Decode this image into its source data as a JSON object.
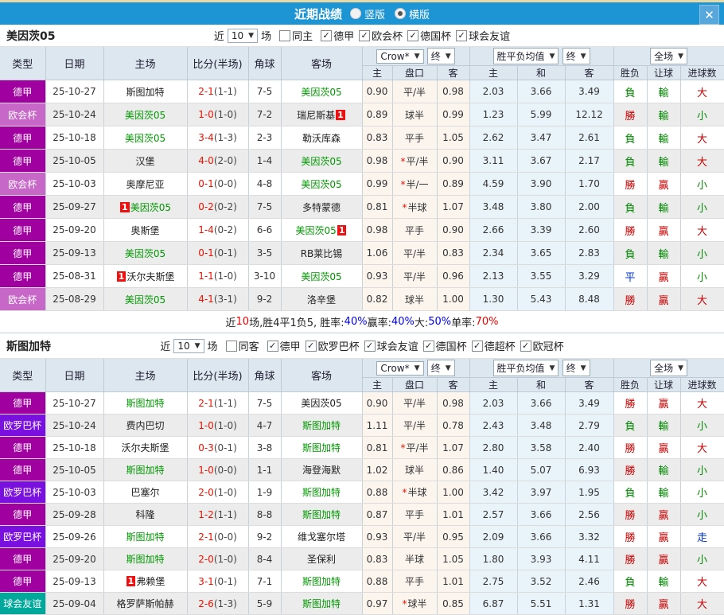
{
  "icons": {
    "close": "✕",
    "dropdown": "▼",
    "check": "✓"
  },
  "titlebar": {
    "title": "近期战绩",
    "radio_vertical": "竖版",
    "radio_horizontal": "横版",
    "selected": "横版"
  },
  "columns": {
    "type": "类型",
    "date": "日期",
    "home": "主场",
    "score": "比分(半场)",
    "corner": "角球",
    "away": "客场",
    "odds_select": "Crow*",
    "final_select": "终",
    "avg_select": "胜平负均值",
    "scope_select": "全场",
    "home_odds": "主",
    "handicap": "盘口",
    "away_odds": "客",
    "avg_home": "主",
    "avg_draw": "和",
    "avg_away": "客",
    "result": "胜负",
    "let_ball": "让球",
    "goals": "进球数"
  },
  "comp_colors": {
    "德甲": "#a000a0",
    "欧会杯": "#c767c7",
    "欧罗巴杯": "#7a10e0",
    "球会友谊": "#00a89b"
  },
  "sections": [
    {
      "team": "美因茨05",
      "filter": {
        "near": "近",
        "games": "10",
        "suffix": "场",
        "same_label": "同主",
        "same_checked": false,
        "leagues": [
          {
            "label": "德甲",
            "checked": true
          },
          {
            "label": "欧会杯",
            "checked": true
          },
          {
            "label": "德国杯",
            "checked": true
          },
          {
            "label": "球会友谊",
            "checked": true
          }
        ]
      },
      "rows": [
        {
          "comp": "德甲",
          "date": "25-10-27",
          "home": "斯图加特",
          "hg": false,
          "hc": null,
          "score": "2-1",
          "half": "(1-1)",
          "corner": "7-5",
          "away": "美因茨05",
          "ag": true,
          "ac": null,
          "odds": [
            "0.90",
            "平/半",
            "0.98"
          ],
          "star": false,
          "avg": [
            "2.03",
            "3.66",
            "3.49"
          ],
          "res": {
            "t": "負",
            "c": "green"
          },
          "let": {
            "t": "輸",
            "c": "green"
          },
          "goal": {
            "t": "大",
            "c": "red"
          }
        },
        {
          "comp": "欧会杯",
          "date": "25-10-24",
          "home": "美因茨05",
          "hg": true,
          "hc": null,
          "score": "1-0",
          "half": "(1-0)",
          "corner": "7-2",
          "away": "瑞尼斯基",
          "ag": false,
          "ac": "after",
          "odds": [
            "0.89",
            "球半",
            "0.99"
          ],
          "star": false,
          "avg": [
            "1.23",
            "5.99",
            "12.12"
          ],
          "res": {
            "t": "勝",
            "c": "red"
          },
          "let": {
            "t": "輸",
            "c": "green"
          },
          "goal": {
            "t": "小",
            "c": "green"
          }
        },
        {
          "comp": "德甲",
          "date": "25-10-18",
          "home": "美因茨05",
          "hg": true,
          "hc": null,
          "score": "3-4",
          "half": "(1-3)",
          "corner": "2-3",
          "away": "勒沃库森",
          "ag": false,
          "ac": null,
          "odds": [
            "0.83",
            "平手",
            "1.05"
          ],
          "star": false,
          "avg": [
            "2.62",
            "3.47",
            "2.61"
          ],
          "res": {
            "t": "負",
            "c": "green"
          },
          "let": {
            "t": "輸",
            "c": "green"
          },
          "goal": {
            "t": "大",
            "c": "red"
          }
        },
        {
          "comp": "德甲",
          "date": "25-10-05",
          "home": "汉堡",
          "hg": false,
          "hc": null,
          "score": "4-0",
          "half": "(2-0)",
          "corner": "1-4",
          "away": "美因茨05",
          "ag": true,
          "ac": null,
          "odds": [
            "0.98",
            "平/半",
            "0.90"
          ],
          "star": true,
          "avg": [
            "3.11",
            "3.67",
            "2.17"
          ],
          "res": {
            "t": "負",
            "c": "green"
          },
          "let": {
            "t": "輸",
            "c": "green"
          },
          "goal": {
            "t": "大",
            "c": "red"
          }
        },
        {
          "comp": "欧会杯",
          "date": "25-10-03",
          "home": "奥摩尼亚",
          "hg": false,
          "hc": null,
          "score": "0-1",
          "half": "(0-0)",
          "corner": "4-8",
          "away": "美因茨05",
          "ag": true,
          "ac": null,
          "odds": [
            "0.99",
            "半/一",
            "0.89"
          ],
          "star": true,
          "avg": [
            "4.59",
            "3.90",
            "1.70"
          ],
          "res": {
            "t": "勝",
            "c": "red"
          },
          "let": {
            "t": "贏",
            "c": "red"
          },
          "goal": {
            "t": "小",
            "c": "green"
          }
        },
        {
          "comp": "德甲",
          "date": "25-09-27",
          "home": "美因茨05",
          "hg": true,
          "hc": "before",
          "score": "0-2",
          "half": "(0-2)",
          "corner": "7-5",
          "away": "多特蒙德",
          "ag": false,
          "ac": null,
          "odds": [
            "0.81",
            "半球",
            "1.07"
          ],
          "star": true,
          "avg": [
            "3.48",
            "3.80",
            "2.00"
          ],
          "res": {
            "t": "負",
            "c": "green"
          },
          "let": {
            "t": "輸",
            "c": "green"
          },
          "goal": {
            "t": "小",
            "c": "green"
          }
        },
        {
          "comp": "德甲",
          "date": "25-09-20",
          "home": "奥斯堡",
          "hg": false,
          "hc": null,
          "score": "1-4",
          "half": "(0-2)",
          "corner": "6-6",
          "away": "美因茨05",
          "ag": true,
          "ac": "after",
          "odds": [
            "0.98",
            "平手",
            "0.90"
          ],
          "star": false,
          "avg": [
            "2.66",
            "3.39",
            "2.60"
          ],
          "res": {
            "t": "勝",
            "c": "red"
          },
          "let": {
            "t": "贏",
            "c": "red"
          },
          "goal": {
            "t": "大",
            "c": "red"
          }
        },
        {
          "comp": "德甲",
          "date": "25-09-13",
          "home": "美因茨05",
          "hg": true,
          "hc": null,
          "score": "0-1",
          "half": "(0-1)",
          "corner": "3-5",
          "away": "RB莱比锡",
          "ag": false,
          "ac": null,
          "odds": [
            "1.06",
            "平/半",
            "0.83"
          ],
          "star": false,
          "avg": [
            "2.34",
            "3.65",
            "2.83"
          ],
          "res": {
            "t": "負",
            "c": "green"
          },
          "let": {
            "t": "輸",
            "c": "green"
          },
          "goal": {
            "t": "小",
            "c": "green"
          }
        },
        {
          "comp": "德甲",
          "date": "25-08-31",
          "home": "沃尔夫斯堡",
          "hg": false,
          "hc": "before",
          "score": "1-1",
          "half": "(1-0)",
          "corner": "3-10",
          "away": "美因茨05",
          "ag": true,
          "ac": null,
          "odds": [
            "0.93",
            "平/半",
            "0.96"
          ],
          "star": false,
          "avg": [
            "2.13",
            "3.55",
            "3.29"
          ],
          "res": {
            "t": "平",
            "c": "blue"
          },
          "let": {
            "t": "贏",
            "c": "red"
          },
          "goal": {
            "t": "小",
            "c": "green"
          }
        },
        {
          "comp": "欧会杯",
          "date": "25-08-29",
          "home": "美因茨05",
          "hg": true,
          "hc": null,
          "score": "4-1",
          "half": "(3-1)",
          "corner": "9-2",
          "away": "洛辛堡",
          "ag": false,
          "ac": null,
          "odds": [
            "0.82",
            "球半",
            "1.00"
          ],
          "star": false,
          "avg": [
            "1.30",
            "5.43",
            "8.48"
          ],
          "res": {
            "t": "勝",
            "c": "red"
          },
          "let": {
            "t": "贏",
            "c": "red"
          },
          "goal": {
            "t": "大",
            "c": "red"
          }
        }
      ],
      "summary": [
        {
          "text": "近",
          "color": "black"
        },
        {
          "text": "10",
          "color": "red"
        },
        {
          "text": "场,胜4平1负5, 胜率:",
          "color": "black"
        },
        {
          "text": "40%",
          "color": "blue"
        },
        {
          "text": " 赢率:",
          "color": "black"
        },
        {
          "text": "40%",
          "color": "blue"
        },
        {
          "text": " 大:",
          "color": "black"
        },
        {
          "text": "50%",
          "color": "blue"
        },
        {
          "text": " 单率:",
          "color": "black"
        },
        {
          "text": "70%",
          "color": "red"
        }
      ]
    },
    {
      "team": "斯图加特",
      "filter": {
        "near": "近",
        "games": "10",
        "suffix": "场",
        "same_label": "同客",
        "same_checked": false,
        "leagues": [
          {
            "label": "德甲",
            "checked": true
          },
          {
            "label": "欧罗巴杯",
            "checked": true
          },
          {
            "label": "球会友谊",
            "checked": true
          },
          {
            "label": "德国杯",
            "checked": true
          },
          {
            "label": "德超杯",
            "checked": true
          },
          {
            "label": "欧冠杯",
            "checked": true
          }
        ]
      },
      "rows": [
        {
          "comp": "德甲",
          "date": "25-10-27",
          "home": "斯图加特",
          "hg": true,
          "hc": null,
          "score": "2-1",
          "half": "(1-1)",
          "corner": "7-5",
          "away": "美因茨05",
          "ag": false,
          "ac": null,
          "odds": [
            "0.90",
            "平/半",
            "0.98"
          ],
          "star": false,
          "avg": [
            "2.03",
            "3.66",
            "3.49"
          ],
          "res": {
            "t": "勝",
            "c": "red"
          },
          "let": {
            "t": "贏",
            "c": "red"
          },
          "goal": {
            "t": "大",
            "c": "red"
          }
        },
        {
          "comp": "欧罗巴杯",
          "date": "25-10-24",
          "home": "费内巴切",
          "hg": false,
          "hc": null,
          "score": "1-0",
          "half": "(1-0)",
          "corner": "4-7",
          "away": "斯图加特",
          "ag": true,
          "ac": null,
          "odds": [
            "1.11",
            "平/半",
            "0.78"
          ],
          "star": false,
          "avg": [
            "2.43",
            "3.48",
            "2.79"
          ],
          "res": {
            "t": "負",
            "c": "green"
          },
          "let": {
            "t": "輸",
            "c": "green"
          },
          "goal": {
            "t": "小",
            "c": "green"
          }
        },
        {
          "comp": "德甲",
          "date": "25-10-18",
          "home": "沃尔夫斯堡",
          "hg": false,
          "hc": null,
          "score": "0-3",
          "half": "(0-1)",
          "corner": "3-8",
          "away": "斯图加特",
          "ag": true,
          "ac": null,
          "odds": [
            "0.81",
            "平/半",
            "1.07"
          ],
          "star": true,
          "avg": [
            "2.80",
            "3.58",
            "2.40"
          ],
          "res": {
            "t": "勝",
            "c": "red"
          },
          "let": {
            "t": "贏",
            "c": "red"
          },
          "goal": {
            "t": "大",
            "c": "red"
          }
        },
        {
          "comp": "德甲",
          "date": "25-10-05",
          "home": "斯图加特",
          "hg": true,
          "hc": null,
          "score": "1-0",
          "half": "(0-0)",
          "corner": "1-1",
          "away": "海登海默",
          "ag": false,
          "ac": null,
          "odds": [
            "1.02",
            "球半",
            "0.86"
          ],
          "star": false,
          "avg": [
            "1.40",
            "5.07",
            "6.93"
          ],
          "res": {
            "t": "勝",
            "c": "red"
          },
          "let": {
            "t": "輸",
            "c": "green"
          },
          "goal": {
            "t": "小",
            "c": "green"
          }
        },
        {
          "comp": "欧罗巴杯",
          "date": "25-10-03",
          "home": "巴塞尔",
          "hg": false,
          "hc": null,
          "score": "2-0",
          "half": "(1-0)",
          "corner": "1-9",
          "away": "斯图加特",
          "ag": true,
          "ac": null,
          "odds": [
            "0.88",
            "半球",
            "1.00"
          ],
          "star": true,
          "avg": [
            "3.42",
            "3.97",
            "1.95"
          ],
          "res": {
            "t": "負",
            "c": "green"
          },
          "let": {
            "t": "輸",
            "c": "green"
          },
          "goal": {
            "t": "小",
            "c": "green"
          }
        },
        {
          "comp": "德甲",
          "date": "25-09-28",
          "home": "科隆",
          "hg": false,
          "hc": null,
          "score": "1-2",
          "half": "(1-1)",
          "corner": "8-8",
          "away": "斯图加特",
          "ag": true,
          "ac": null,
          "odds": [
            "0.87",
            "平手",
            "1.01"
          ],
          "star": false,
          "avg": [
            "2.57",
            "3.66",
            "2.56"
          ],
          "res": {
            "t": "勝",
            "c": "red"
          },
          "let": {
            "t": "贏",
            "c": "red"
          },
          "goal": {
            "t": "小",
            "c": "green"
          }
        },
        {
          "comp": "欧罗巴杯",
          "date": "25-09-26",
          "home": "斯图加特",
          "hg": true,
          "hc": null,
          "score": "2-1",
          "half": "(0-0)",
          "corner": "9-2",
          "away": "维戈塞尔塔",
          "ag": false,
          "ac": null,
          "odds": [
            "0.93",
            "平/半",
            "0.95"
          ],
          "star": false,
          "avg": [
            "2.09",
            "3.66",
            "3.32"
          ],
          "res": {
            "t": "勝",
            "c": "red"
          },
          "let": {
            "t": "贏",
            "c": "red"
          },
          "goal": {
            "t": "走",
            "c": "blue"
          }
        },
        {
          "comp": "德甲",
          "date": "25-09-20",
          "home": "斯图加特",
          "hg": true,
          "hc": null,
          "score": "2-0",
          "half": "(1-0)",
          "corner": "8-4",
          "away": "圣保利",
          "ag": false,
          "ac": null,
          "odds": [
            "0.83",
            "半球",
            "1.05"
          ],
          "star": false,
          "avg": [
            "1.80",
            "3.93",
            "4.11"
          ],
          "res": {
            "t": "勝",
            "c": "red"
          },
          "let": {
            "t": "贏",
            "c": "red"
          },
          "goal": {
            "t": "小",
            "c": "green"
          }
        },
        {
          "comp": "德甲",
          "date": "25-09-13",
          "home": "弗赖堡",
          "hg": false,
          "hc": "before",
          "score": "3-1",
          "half": "(0-1)",
          "corner": "7-1",
          "away": "斯图加特",
          "ag": true,
          "ac": null,
          "odds": [
            "0.88",
            "平手",
            "1.01"
          ],
          "star": false,
          "avg": [
            "2.75",
            "3.52",
            "2.46"
          ],
          "res": {
            "t": "負",
            "c": "green"
          },
          "let": {
            "t": "輸",
            "c": "green"
          },
          "goal": {
            "t": "大",
            "c": "red"
          }
        },
        {
          "comp": "球会友谊",
          "date": "25-09-04",
          "home": "格罗萨斯帕赫",
          "hg": false,
          "hc": null,
          "score": "2-6",
          "half": "(1-3)",
          "corner": "5-9",
          "away": "斯图加特",
          "ag": true,
          "ac": null,
          "odds": [
            "0.97",
            "球半",
            "0.85"
          ],
          "star": true,
          "avg": [
            "6.87",
            "5.51",
            "1.31"
          ],
          "res": {
            "t": "勝",
            "c": "red"
          },
          "let": {
            "t": "贏",
            "c": "red"
          },
          "goal": {
            "t": "大",
            "c": "red"
          }
        }
      ],
      "summary": null
    }
  ]
}
